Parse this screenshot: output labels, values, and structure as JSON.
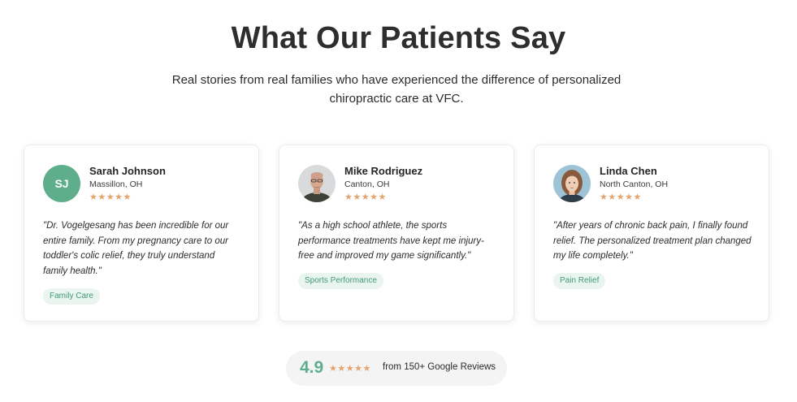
{
  "header": {
    "title": "What Our Patients Say",
    "subtitle_line1": "Real stories from real families who have experienced the difference of personalized",
    "subtitle_line2": "chiropractic care at VFC."
  },
  "testimonials": [
    {
      "avatar_initials": "SJ",
      "name": "Sarah Johnson",
      "location": "Massillon, OH",
      "stars": "★★★★★",
      "rating": 5,
      "quote_lines": [
        "\"Dr. Vogelgesang has been incredible for our",
        "entire family. From my pregnancy care to our",
        "toddler's colic relief, they truly understand",
        "family health.\""
      ],
      "tag": "Family Care"
    },
    {
      "avatar_icon": "man-portrait-photo",
      "name": "Mike Rodriguez",
      "location": "Canton, OH",
      "stars": "★★★★★",
      "rating": 5,
      "quote_lines": [
        "\"As a high school athlete, the sports",
        "performance treatments have kept me injury-",
        "free and improved my game significantly.\""
      ],
      "tag": "Sports Performance"
    },
    {
      "avatar_icon": "woman-portrait-photo",
      "name": "Linda Chen",
      "location": "North Canton, OH",
      "stars": "★★★★★",
      "rating": 5,
      "quote_lines": [
        "\"After years of chronic back pain, I finally found",
        "relief. The personalized treatment plan changed",
        "my life completely.\""
      ],
      "tag": "Pain Relief"
    }
  ],
  "summary": {
    "score": "4.9",
    "stars": "★★★★★",
    "text": "from 150+ Google Reviews"
  },
  "colors": {
    "accent_green": "#5eae8b",
    "star_orange": "#e8a36a",
    "tag_bg": "#eaf5ef",
    "tag_text": "#3f9a72"
  }
}
